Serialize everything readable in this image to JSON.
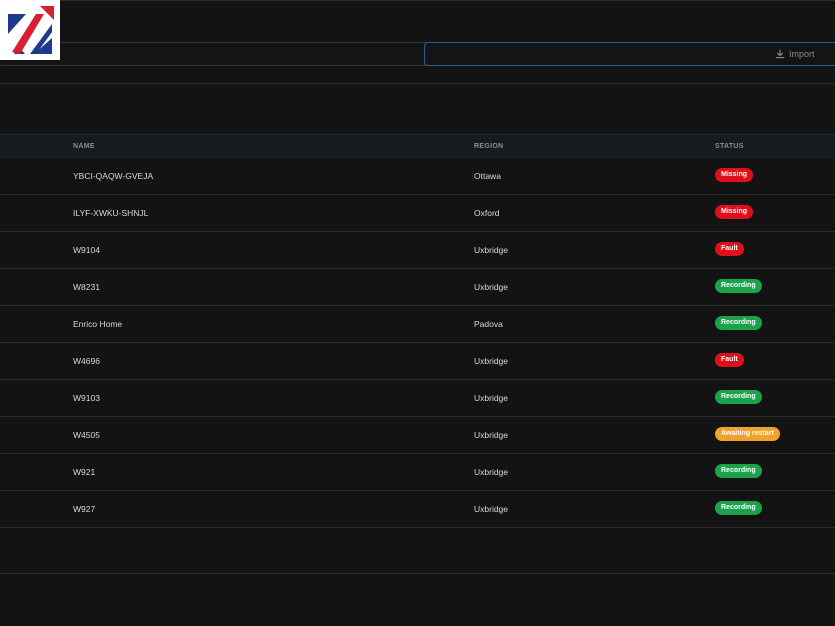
{
  "logo": {
    "name": "brand-logo",
    "colors": {
      "blue": "#1f3a8a",
      "red": "#d71f2f"
    }
  },
  "search": {
    "value": "",
    "placeholder": ""
  },
  "import": {
    "label": "Import",
    "icon": "download-icon"
  },
  "table": {
    "headers": {
      "name": "NAME",
      "region": "REGION",
      "status": "STATUS"
    },
    "rows": [
      {
        "name": "YBCI-QAQW-GVEJA",
        "region": "Ottawa",
        "status": "Missing",
        "status_color": "#e0101a"
      },
      {
        "name": "ILYF-XWKU-SHNJL",
        "region": "Oxford",
        "status": "Missing",
        "status_color": "#e0101a"
      },
      {
        "name": "W9104",
        "region": "Uxbridge",
        "status": "Fault",
        "status_color": "#e0101a"
      },
      {
        "name": "W8231",
        "region": "Uxbridge",
        "status": "Recording",
        "status_color": "#1aa34a"
      },
      {
        "name": "Enrico Home",
        "region": "Padova",
        "status": "Recording",
        "status_color": "#1aa34a"
      },
      {
        "name": "W4696",
        "region": "Uxbridge",
        "status": "Fault",
        "status_color": "#e0101a"
      },
      {
        "name": "W9103",
        "region": "Uxbridge",
        "status": "Recording",
        "status_color": "#1aa34a"
      },
      {
        "name": "W4505",
        "region": "Uxbridge",
        "status": "Awaiting restart",
        "status_color": "#f0a32a"
      },
      {
        "name": "W921",
        "region": "Uxbridge",
        "status": "Recording",
        "status_color": "#1aa34a"
      },
      {
        "name": "W927",
        "region": "Uxbridge",
        "status": "Recording",
        "status_color": "#1aa34a"
      }
    ]
  }
}
